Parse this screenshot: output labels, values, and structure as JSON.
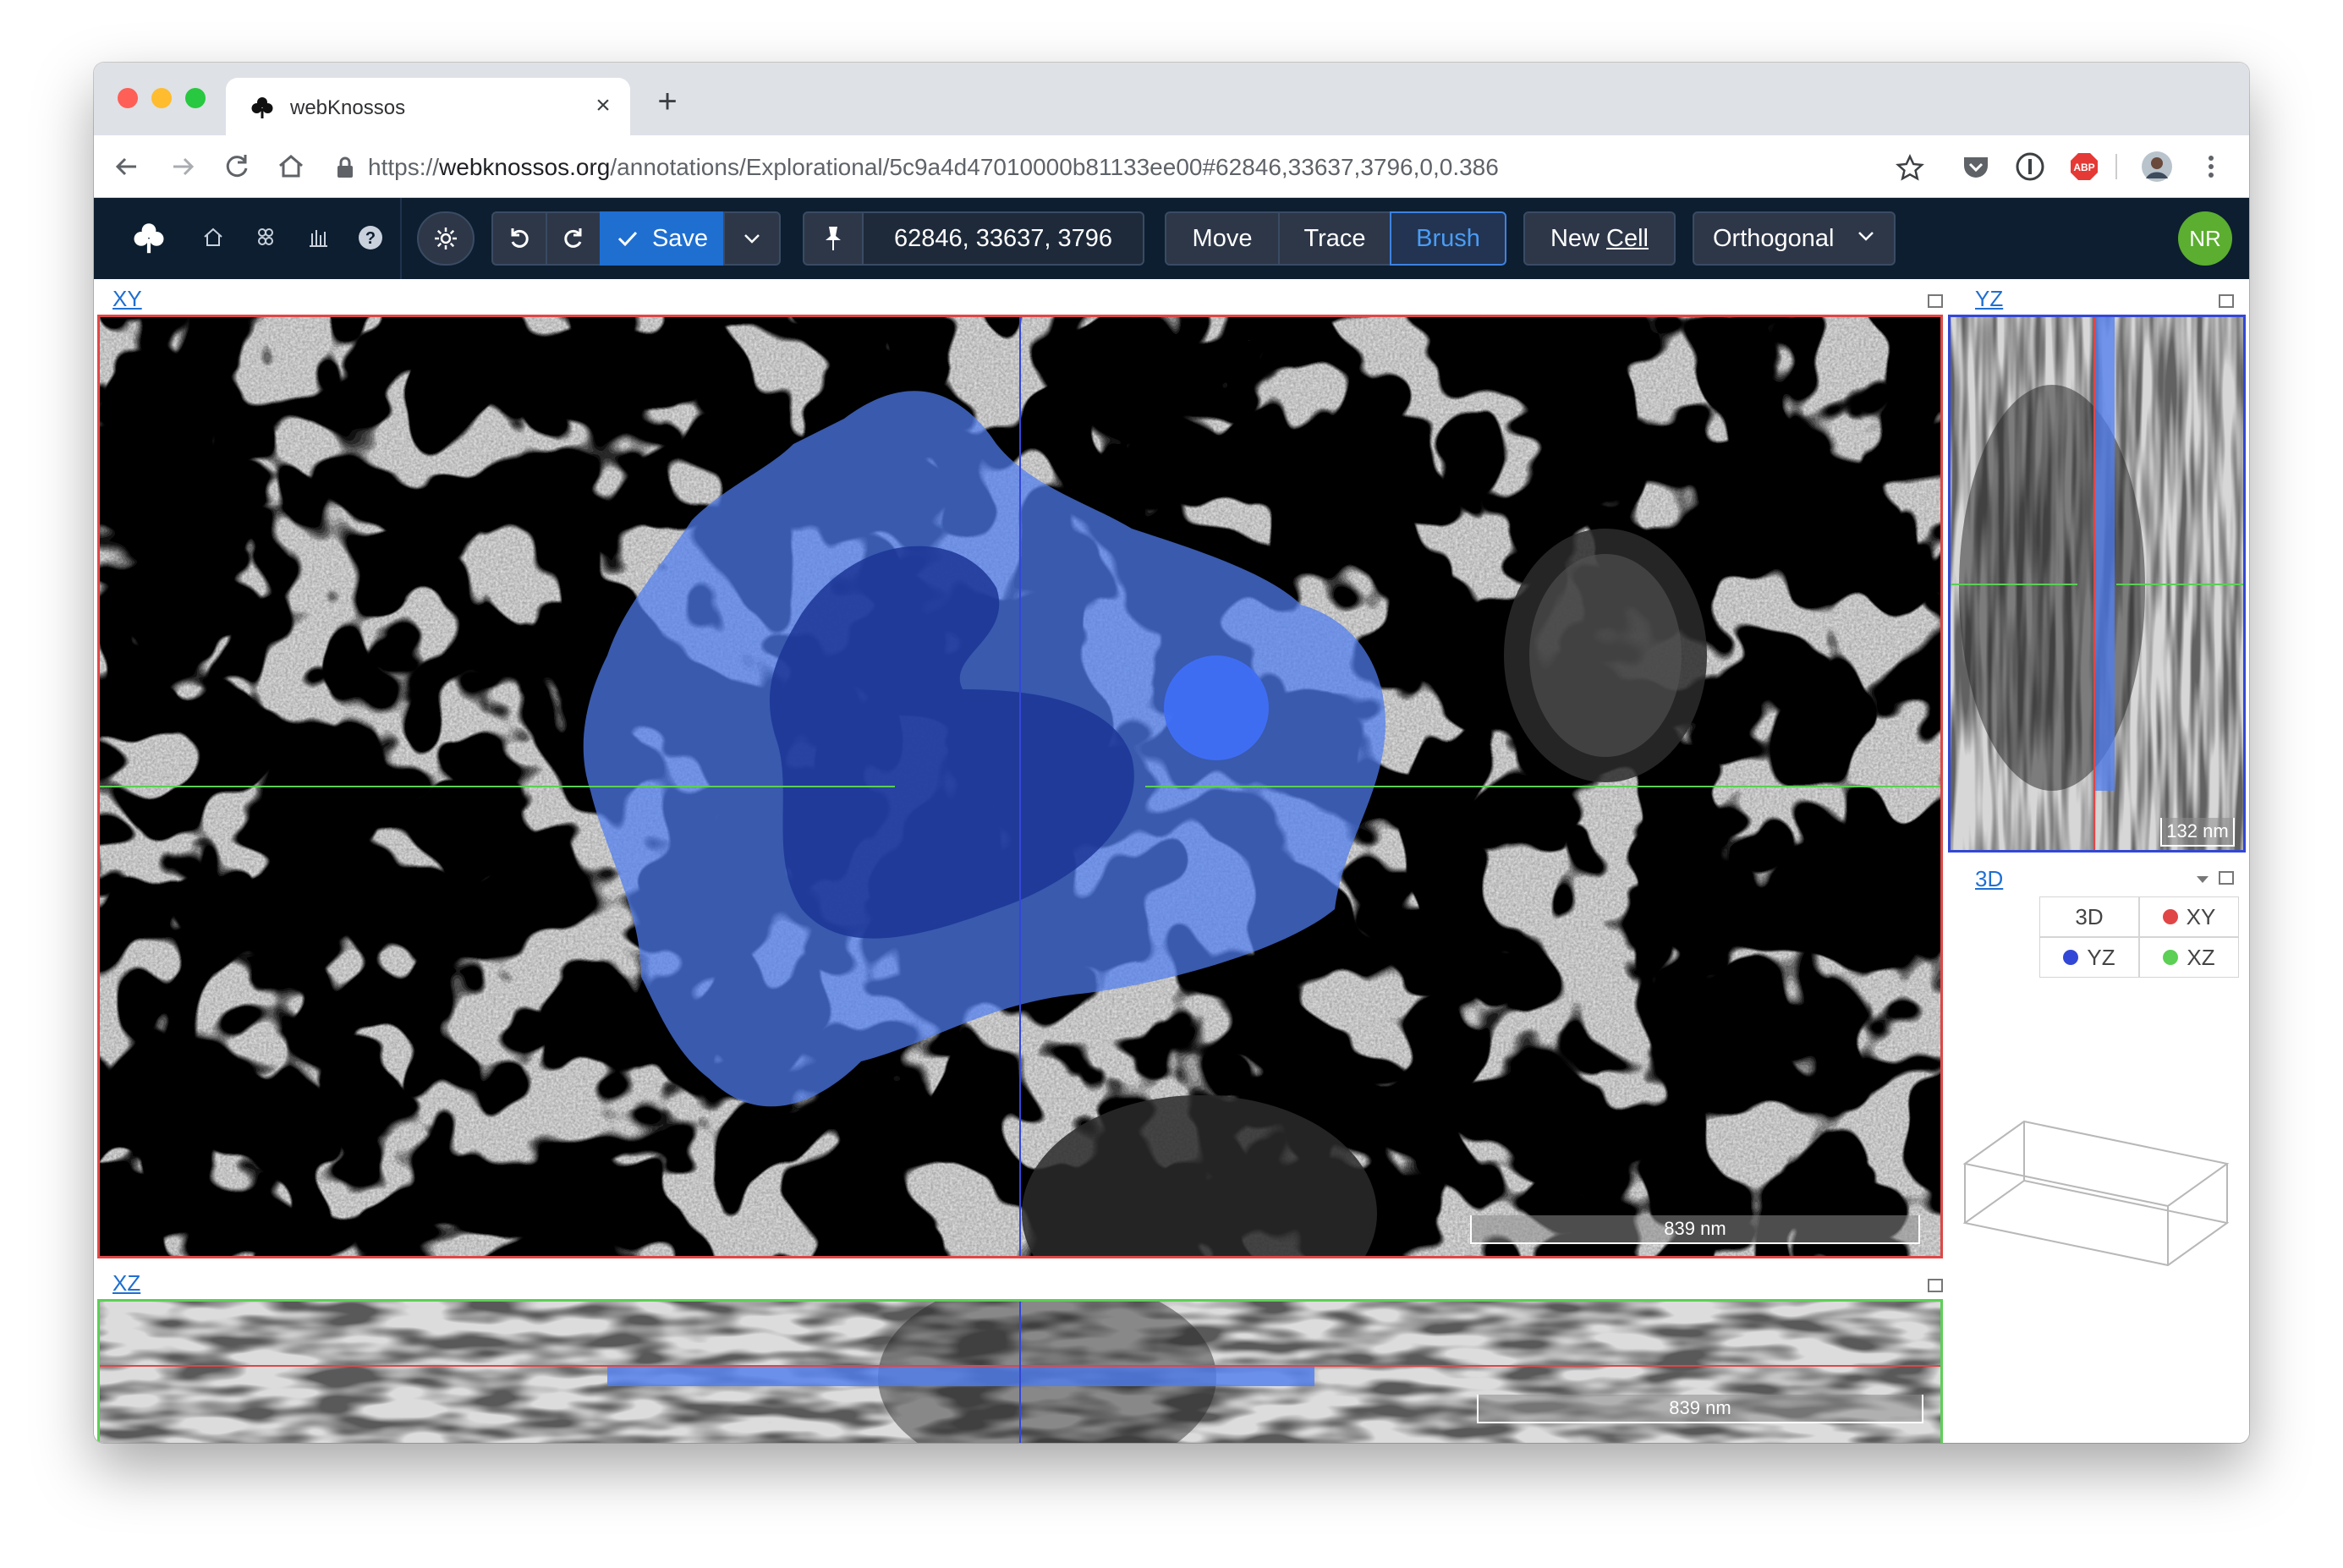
{
  "browser": {
    "tab_title": "webKnossos",
    "url_scheme": "https://",
    "url_host": "webknossos.org",
    "url_path": "/annotations/Explorational/5c9a4d47010000b81133ee00#62846,33637,3796,0,0.386"
  },
  "toolbar": {
    "save_label": "Save",
    "position": "62846, 33637, 3796",
    "modes": [
      "Move",
      "Trace",
      "Brush"
    ],
    "active_mode": "Brush",
    "new_cell_label": "New",
    "new_cell_label_2": "Cell",
    "view_mode": "Orthogonal",
    "user_initials": "NR"
  },
  "viewports": {
    "xy": {
      "label": "XY",
      "scale": "839 nm"
    },
    "yz": {
      "label": "YZ",
      "scale": "132 nm"
    },
    "xz": {
      "label": "XZ",
      "scale": "839 nm"
    },
    "td": {
      "label": "3D",
      "buttons": [
        "3D",
        "XY",
        "YZ",
        "XZ"
      ]
    }
  },
  "colors": {
    "xy_border": "#e04646",
    "yz_border": "#3347d6",
    "xz_border": "#5ccf55",
    "segment": "#4f7df0",
    "toolbar_bg": "#0c1e30",
    "active_mode": "#4b9cf5"
  }
}
